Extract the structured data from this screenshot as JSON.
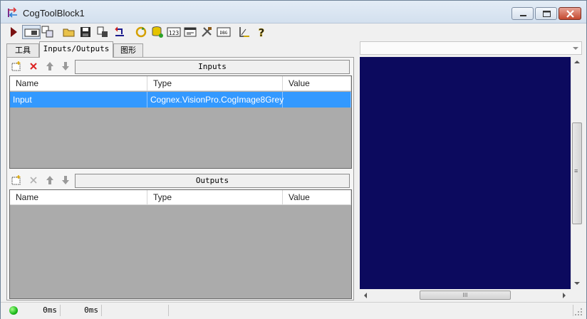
{
  "window": {
    "title": "CogToolBlock1"
  },
  "toolbar": {
    "buttons": [
      "run-icon",
      "display-toggle-icon",
      "results-icon",
      "open-folder-icon",
      "save-icon",
      "import-icon",
      "reset-icon",
      "refresh-icon",
      "database-icon",
      "numeric-icon",
      "window-icon",
      "tools-icon",
      "debug-icon",
      "measure-icon",
      "help-icon"
    ],
    "numeric_label": "123",
    "debug_label": "DBG"
  },
  "tabs": [
    {
      "label": "工具",
      "active": false
    },
    {
      "label": "Inputs/Outputs",
      "active": true
    },
    {
      "label": "图形",
      "active": false
    }
  ],
  "inputs": {
    "header": "Inputs",
    "columns": [
      "Name",
      "Type",
      "Value"
    ],
    "rows": [
      {
        "name": "Input",
        "type": "Cognex.VisionPro.CogImage8Grey",
        "value": ""
      }
    ]
  },
  "outputs": {
    "header": "Outputs",
    "columns": [
      "Name",
      "Type",
      "Value"
    ],
    "rows": []
  },
  "display": {
    "background_color": "#0c0a5e",
    "hscroll_grip": "III",
    "vscroll_grip": "≡"
  },
  "status": {
    "led_color": "#1bb91b",
    "time1": "0ms",
    "time2": "0ms"
  },
  "colors": {
    "selection": "#3399ff",
    "grid_empty": "#ababab"
  }
}
